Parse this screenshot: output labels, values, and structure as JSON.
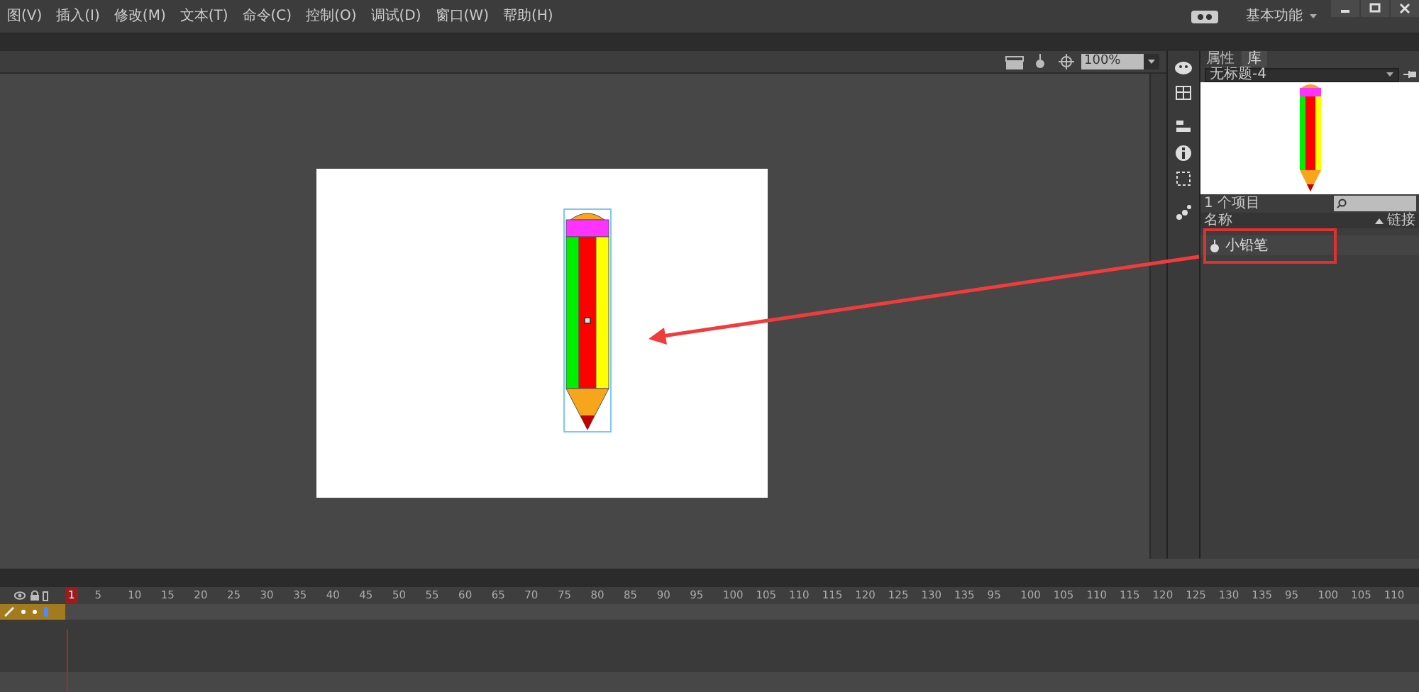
{
  "menu": [
    "图(V)",
    "插入(I)",
    "修改(M)",
    "文本(T)",
    "命令(C)",
    "控制(O)",
    "调试(D)",
    "窗口(W)",
    "帮助(H)"
  ],
  "workspace": {
    "label": "基本功能"
  },
  "zoom": {
    "value": "100%"
  },
  "library": {
    "tabs": [
      {
        "label": "属性",
        "selected": false
      },
      {
        "label": "库",
        "selected": true
      }
    ],
    "document": "无标题-4",
    "item_count": "1 个项目",
    "columns": [
      "名称",
      "链接"
    ],
    "items": [
      {
        "name": "小铅笔"
      }
    ]
  },
  "timeline": {
    "playhead": "1",
    "ruler": [
      "5",
      "10",
      "15",
      "20",
      "25",
      "30",
      "35",
      "40",
      "45",
      "50",
      "55",
      "60",
      "65",
      "70",
      "75",
      "80",
      "85",
      "90",
      "95",
      "100",
      "105",
      "110",
      "115",
      "120",
      "125",
      "130",
      "135",
      "95",
      "100",
      "105",
      "110",
      "115",
      "120",
      "125",
      "130",
      "135",
      "95",
      "100",
      "105",
      "110"
    ],
    "layers": [
      {
        "selected": true
      }
    ]
  }
}
